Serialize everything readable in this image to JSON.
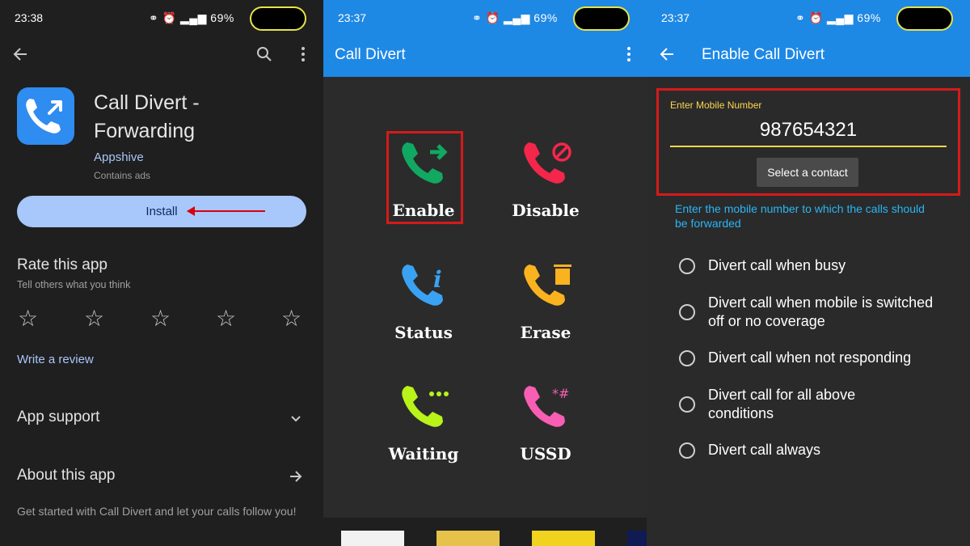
{
  "colors": {
    "playstore_bg": "#1f1f1f",
    "accent_blue": "#a8c7fa",
    "appbar_blue": "#1e88e5",
    "highlight_red": "#d51a1a",
    "field_yellow": "#ffd54f",
    "hint_cyan": "#29b6f6"
  },
  "playstore": {
    "status": {
      "time": "23:38",
      "battery": "69%"
    },
    "app": {
      "title_line1": "Call Divert -",
      "title_line2": "Forwarding",
      "developer": "Appshive",
      "ads_note": "Contains ads",
      "icon": "phone-forward-icon"
    },
    "install_label": "Install",
    "rate": {
      "title": "Rate this app",
      "subtitle": "Tell others what you think",
      "star_count": 5,
      "stars_filled": 0
    },
    "write_review": "Write a review",
    "app_support": "App support",
    "about": "About this app",
    "description": "Get started with Call Divert and let your calls follow you!"
  },
  "call_divert": {
    "status": {
      "time": "23:37",
      "battery": "69%"
    },
    "title": "Call Divert",
    "buttons": [
      {
        "label": "Enable",
        "icon": "phone-arrow-icon",
        "color": "#11a862"
      },
      {
        "label": "Disable",
        "icon": "phone-block-icon",
        "color": "#f4264b"
      },
      {
        "label": "Status",
        "icon": "phone-info-icon",
        "color": "#3aa2f3"
      },
      {
        "label": "Erase",
        "icon": "phone-trash-icon",
        "color": "#fbb21f"
      },
      {
        "label": "Waiting",
        "icon": "phone-dots-icon",
        "color": "#b8f319"
      },
      {
        "label": "USSD",
        "icon": "phone-hash-icon",
        "color": "#f85eb3"
      }
    ],
    "ussd_symbols": "*#"
  },
  "enable_divert": {
    "status": {
      "time": "23:37",
      "battery": "69%"
    },
    "title": "Enable Call Divert",
    "field_label": "Enter Mobile Number",
    "number": "987654321",
    "select_contact": "Select a contact",
    "hint": "Enter the mobile number to which the calls should be forwarded",
    "options": [
      {
        "label": "Divert call when busy"
      },
      {
        "label": "Divert call when mobile is switched off or no coverage"
      },
      {
        "label": "Divert call when not responding"
      },
      {
        "label": "Divert call for all above conditions"
      },
      {
        "label": "Divert call always"
      }
    ]
  }
}
